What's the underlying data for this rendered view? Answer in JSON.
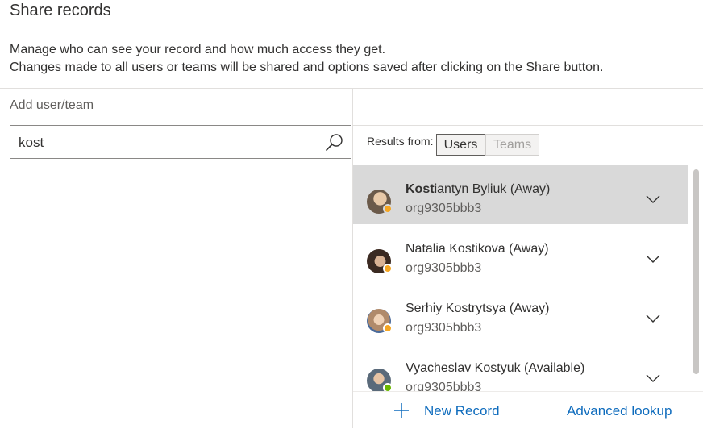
{
  "dialog": {
    "title": "Share records",
    "description_line1": "Manage who can see your record and how much access they get.",
    "description_line2": "Changes made to all users or teams will be shared and options saved after clicking on the Share button."
  },
  "left": {
    "add_label": "Add user/team",
    "search_value": "kost",
    "search_icon": "search-icon"
  },
  "results": {
    "from_label": "Results from:",
    "tabs": [
      {
        "label": "Users",
        "active": true
      },
      {
        "label": "Teams",
        "active": false
      }
    ],
    "items": [
      {
        "match": "Kost",
        "rest": "iantyn Byliuk (Away)",
        "sub": "org9305bbb3",
        "status": "Away",
        "status_color": "#f5a623",
        "selected": true,
        "avatar_color": "#6b5a4a"
      },
      {
        "match": "",
        "rest": "Natalia Kostikova (Away)",
        "sub": "org9305bbb3",
        "status": "Away",
        "status_color": "#f5a623",
        "selected": false,
        "avatar_color": "#3b2a22"
      },
      {
        "match": "",
        "rest": "Serhiy Kostrytsya (Away)",
        "sub": "org9305bbb3",
        "status": "Away",
        "status_color": "#f5a623",
        "selected": false,
        "avatar_color": "#b08a6a"
      },
      {
        "match": "",
        "rest": "Vyacheslav Kostyuk (Available)",
        "sub": "org9305bbb3",
        "status": "Available",
        "status_color": "#6bb700",
        "selected": false,
        "avatar_color": "#5a6a7a"
      }
    ]
  },
  "footer": {
    "new_record_label": "New Record",
    "advanced_lookup_label": "Advanced lookup"
  },
  "colors": {
    "link": "#0f6cbd",
    "selected_row": "#d9d9d9"
  }
}
